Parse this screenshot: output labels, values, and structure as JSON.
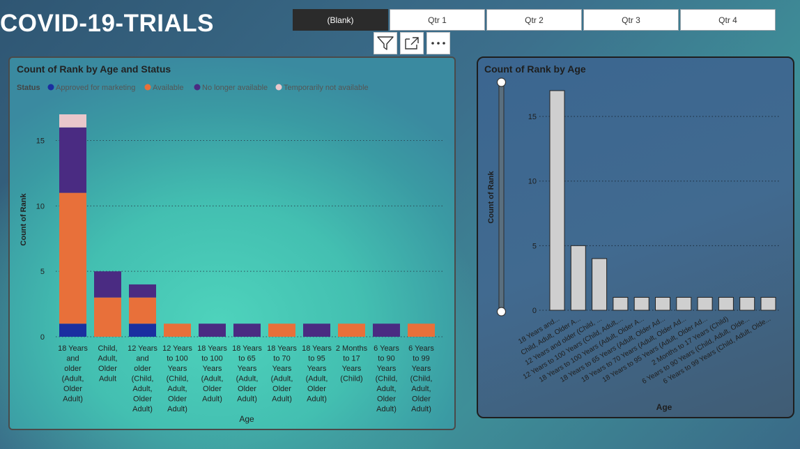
{
  "page": {
    "title": "COVID-19-TRIALS"
  },
  "slicer": {
    "items": [
      {
        "label": "(Blank)",
        "selected": true
      },
      {
        "label": "Qtr 1",
        "selected": false
      },
      {
        "label": "Qtr 2",
        "selected": false
      },
      {
        "label": "Qtr 3",
        "selected": false
      },
      {
        "label": "Qtr 4",
        "selected": false
      }
    ]
  },
  "visual_header": {
    "icons": [
      "filter-icon",
      "focus-mode-icon",
      "more-options-icon"
    ]
  },
  "colors": {
    "approved": "#1a2fa0",
    "available": "#e8703a",
    "no_longer": "#4a2b82",
    "temp_not": "#e9c7cb",
    "bar_grey": "#cfcfcf"
  },
  "chart_data": [
    {
      "type": "bar",
      "stacked": true,
      "title": "Count of Rank by Age and Status",
      "legend_title": "Status",
      "legend_position": "top-left",
      "xlabel": "Age",
      "ylabel": "Count of Rank",
      "ylim": [
        0,
        17
      ],
      "yticks": [
        0,
        5,
        10,
        15
      ],
      "grid": true,
      "categories": [
        [
          "18 Years",
          "and",
          "older",
          "(Adult,",
          "Older",
          "Adult)"
        ],
        [
          "Child,",
          "Adult,",
          "Older",
          "Adult"
        ],
        [
          "12 Years",
          "and",
          "older",
          "(Child,",
          "Adult,",
          "Older",
          "Adult)"
        ],
        [
          "12 Years",
          "to 100",
          "Years",
          "(Child,",
          "Adult,",
          "Older",
          "Adult)"
        ],
        [
          "18 Years",
          "to 100",
          "Years",
          "(Adult,",
          "Older",
          "Adult)"
        ],
        [
          "18 Years",
          "to 65",
          "Years",
          "(Adult,",
          "Older",
          "Adult)"
        ],
        [
          "18 Years",
          "to 70",
          "Years",
          "(Adult,",
          "Older",
          "Adult)"
        ],
        [
          "18 Years",
          "to 95",
          "Years",
          "(Adult,",
          "Older",
          "Adult)"
        ],
        [
          "2 Months",
          "to 17",
          "Years",
          "(Child)"
        ],
        [
          "6 Years",
          "to 90",
          "Years",
          "(Child,",
          "Adult,",
          "Older",
          "Adult)"
        ],
        [
          "6 Years",
          "to 99",
          "Years",
          "(Child,",
          "Adult,",
          "Older",
          "Adult)"
        ]
      ],
      "series": [
        {
          "name": "Approved for marketing",
          "color": "#1a2fa0",
          "values": [
            1,
            0,
            1,
            0,
            0,
            0,
            0,
            0,
            0,
            0,
            0
          ]
        },
        {
          "name": "Available",
          "color": "#e8703a",
          "values": [
            10,
            3,
            2,
            1,
            0,
            0,
            1,
            0,
            1,
            0,
            1
          ]
        },
        {
          "name": "No longer available",
          "color": "#4a2b82",
          "values": [
            5,
            2,
            1,
            0,
            1,
            1,
            0,
            1,
            0,
            1,
            0
          ]
        },
        {
          "name": "Temporarily not available",
          "color": "#e9c7cb",
          "values": [
            1,
            0,
            0,
            0,
            0,
            0,
            0,
            0,
            0,
            0,
            0
          ]
        }
      ]
    },
    {
      "type": "bar",
      "title": "Count of Rank by Age",
      "xlabel": "Age",
      "ylabel": "Count of Rank",
      "ylim": [
        0,
        17
      ],
      "yticks": [
        0,
        5,
        10,
        15
      ],
      "grid": true,
      "categories": [
        "18 Years and...",
        "Child, Adult, Older A...",
        "12 Years and older  (Child, ...",
        "12 Years to 100 Years  (Child, Adult,...",
        "18 Years to 100 Years  (Adult, Older A...",
        "18 Years to 65 Years  (Adult, Older Ad...",
        "18 Years to 70 Years  (Adult, Older Ad...",
        "18 Years to 95 Years  (Adult, Older Ad...",
        "2 Months to 17 Years  (Child)",
        "6 Years to 90 Years  (Child, Adult, Olde...",
        "6 Years to 99 Years  (Child, Adult, Olde..."
      ],
      "values": [
        17,
        5,
        4,
        1,
        1,
        1,
        1,
        1,
        1,
        1,
        1
      ]
    }
  ]
}
